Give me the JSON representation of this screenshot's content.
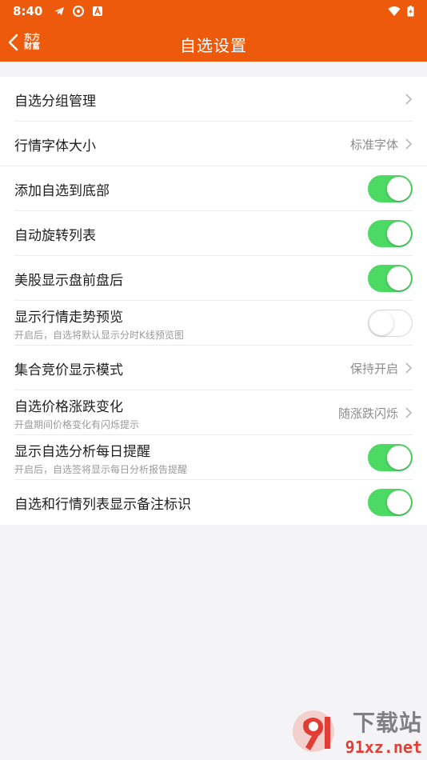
{
  "status": {
    "time": "8:40"
  },
  "header": {
    "brand_line1": "东方",
    "brand_line2": "财富",
    "title": "自选设置"
  },
  "settings": [
    {
      "label": "自选分组管理",
      "sub": "",
      "type": "nav",
      "value": ""
    },
    {
      "label": "行情字体大小",
      "sub": "",
      "type": "nav",
      "value": "标准字体"
    },
    {
      "label": "添加自选到底部",
      "sub": "",
      "type": "toggle",
      "on": true
    },
    {
      "label": "自动旋转列表",
      "sub": "",
      "type": "toggle",
      "on": true
    },
    {
      "label": "美股显示盘前盘后",
      "sub": "",
      "type": "toggle",
      "on": true
    },
    {
      "label": "显示行情走势预览",
      "sub": "开启后，自选将默认显示分时K线预览图",
      "type": "toggle",
      "on": false
    },
    {
      "label": "集合竞价显示模式",
      "sub": "",
      "type": "nav",
      "value": "保持开启"
    },
    {
      "label": "自选价格涨跌变化",
      "sub": "开盘期间价格变化有闪烁提示",
      "type": "nav",
      "value": "随涨跌闪烁"
    },
    {
      "label": "显示自选分析每日提醒",
      "sub": "开启后，自选签将显示每日分析报告提醒",
      "type": "toggle",
      "on": true
    },
    {
      "label": "自选和行情列表显示备注标识",
      "sub": "",
      "type": "toggle",
      "on": true
    }
  ],
  "watermark": {
    "cn": "下载站",
    "url": "91xz.net"
  },
  "colors": {
    "accent": "#ee5a0c",
    "toggle_on": "#4cd964"
  }
}
